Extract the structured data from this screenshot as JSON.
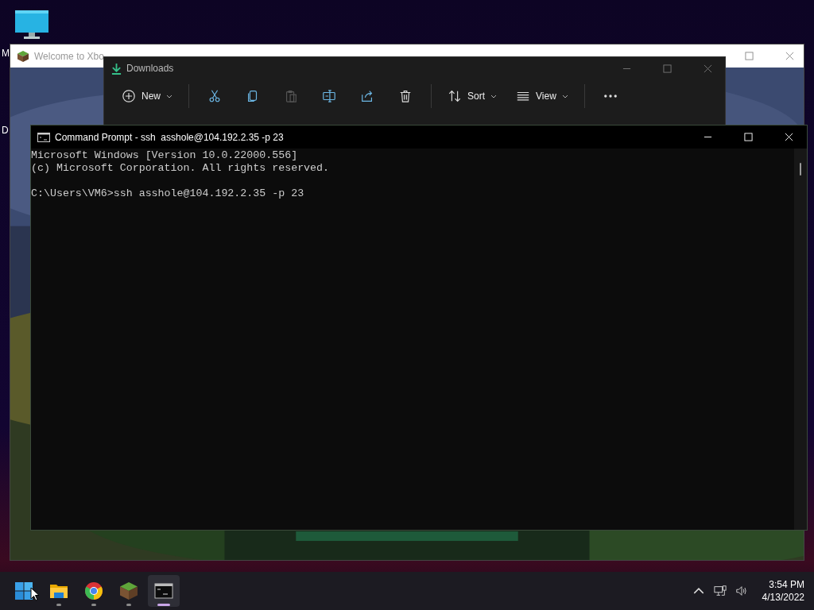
{
  "desktop_icons": [
    {
      "label": "M"
    },
    {
      "label": "D"
    }
  ],
  "xbox_window": {
    "title": "Welcome to Xbo"
  },
  "downloads_window": {
    "title": "Downloads",
    "toolbar": [
      {
        "kind": "new",
        "label": "New",
        "disabled": false
      },
      {
        "kind": "separator"
      },
      {
        "kind": "cut",
        "disabled": false
      },
      {
        "kind": "copy",
        "disabled": false
      },
      {
        "kind": "paste",
        "disabled": true
      },
      {
        "kind": "rename",
        "disabled": false
      },
      {
        "kind": "share",
        "disabled": false
      },
      {
        "kind": "delete",
        "disabled": false
      },
      {
        "kind": "separator"
      },
      {
        "kind": "sort",
        "label": "Sort",
        "disabled": false
      },
      {
        "kind": "view",
        "label": "View",
        "disabled": false
      },
      {
        "kind": "separator"
      },
      {
        "kind": "more",
        "disabled": false
      }
    ]
  },
  "cmd_window": {
    "title": "Command Prompt - ssh  asshole@104.192.2.35 -p 23",
    "blocks": [
      [
        "Microsoft Windows [Version 10.0.22000.556]",
        "(c) Microsoft Corporation. All rights reserved."
      ],
      [
        "C:\\Users\\VM6>ssh asshole@104.192.2.35 -p 23"
      ]
    ]
  },
  "taskbar": {
    "apps": [
      {
        "kind": "start",
        "running": false,
        "active": false
      },
      {
        "kind": "explorer",
        "running": true,
        "active": false
      },
      {
        "kind": "browser",
        "running": true,
        "active": false
      },
      {
        "kind": "grass-block",
        "running": true,
        "active": false
      },
      {
        "kind": "terminal",
        "running": true,
        "active": true
      }
    ],
    "time": "3:54 PM",
    "date": "4/13/2022"
  }
}
